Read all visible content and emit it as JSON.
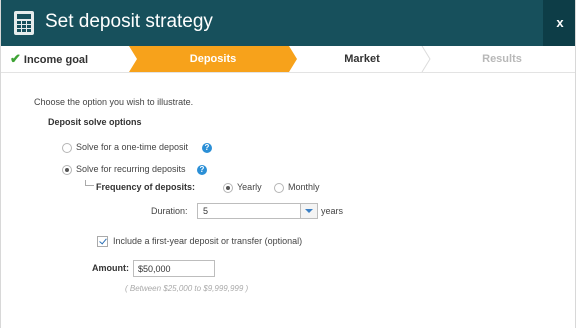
{
  "dialog": {
    "title": "Set deposit strategy",
    "close": "x"
  },
  "steps": [
    {
      "label": "Income goal",
      "state": "completed"
    },
    {
      "label": "Deposits",
      "state": "active"
    },
    {
      "label": "Market",
      "state": "upcoming"
    },
    {
      "label": "Results",
      "state": "disabled"
    }
  ],
  "form": {
    "intro": "Choose the option you wish to illustrate.",
    "section_title": "Deposit solve options",
    "option_one_time": "Solve for a one-time deposit",
    "option_recurring": "Solve for recurring deposits",
    "selected_option": "recurring",
    "frequency_label": "Frequency of deposits:",
    "frequency_yearly": "Yearly",
    "frequency_monthly": "Monthly",
    "selected_frequency": "Yearly",
    "duration_label": "Duration:",
    "duration_value": "5",
    "duration_unit": "years",
    "first_year_label": "Include a first-year deposit or transfer (optional)",
    "first_year_checked": true,
    "amount_label": "Amount:",
    "amount_value": "$50,000",
    "amount_hint": "( Between $25,000 to $9,999,999 )"
  },
  "colors": {
    "titlebar": "#17505c",
    "active_step": "#f7a21b",
    "check": "#3ea335",
    "info": "#2b8fd6"
  }
}
